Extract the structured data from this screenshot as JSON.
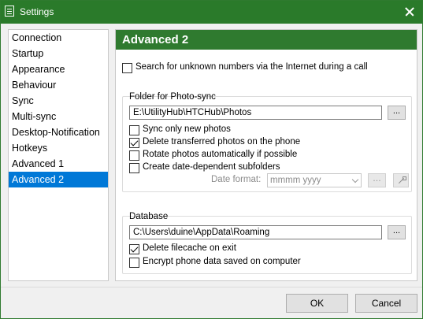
{
  "window": {
    "title": "Settings",
    "accent_color": "#2a7a2a",
    "selection_color": "#0078d7"
  },
  "sidebar": {
    "items": [
      {
        "label": "Connection",
        "selected": false
      },
      {
        "label": "Startup",
        "selected": false
      },
      {
        "label": "Appearance",
        "selected": false
      },
      {
        "label": "Behaviour",
        "selected": false
      },
      {
        "label": "Sync",
        "selected": false
      },
      {
        "label": "Multi-sync",
        "selected": false
      },
      {
        "label": "Desktop-Notification",
        "selected": false
      },
      {
        "label": "Hotkeys",
        "selected": false
      },
      {
        "label": "Advanced 1",
        "selected": false
      },
      {
        "label": "Advanced 2",
        "selected": true
      }
    ]
  },
  "panel": {
    "title": "Advanced 2",
    "search_unknown": {
      "label": "Search for unknown numbers via the Internet during a call",
      "checked": false
    },
    "photo_sync": {
      "title": "Folder for Photo-sync",
      "path": "E:\\UtilityHub\\HTCHub\\Photos",
      "browse_label": "...",
      "options": [
        {
          "label": "Sync only new photos",
          "checked": false
        },
        {
          "label": "Delete transferred photos on the phone",
          "checked": true
        },
        {
          "label": "Rotate photos automatically if possible",
          "checked": false
        },
        {
          "label": "Create date-dependent subfolders",
          "checked": false
        }
      ],
      "date_format_label": "Date format:",
      "date_format_value": "mmmm yyyy",
      "date_btn_label": "..."
    },
    "database": {
      "title": "Database",
      "path": "C:\\Users\\duine\\AppData\\Roaming",
      "browse_label": "...",
      "options": [
        {
          "label": "Delete filecache on exit",
          "checked": true
        },
        {
          "label": "Encrypt phone data saved on computer",
          "checked": false
        }
      ]
    }
  },
  "footer": {
    "ok_label": "OK",
    "cancel_label": "Cancel"
  }
}
